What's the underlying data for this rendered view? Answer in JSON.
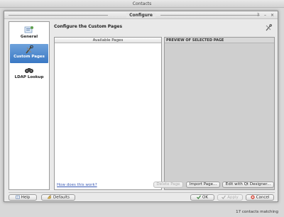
{
  "outer_window": {
    "title": "Contacts",
    "status": "17 contacts matching"
  },
  "dialog": {
    "title": "Configure",
    "window_buttons": [
      "?",
      "–",
      "×"
    ]
  },
  "sidebar": {
    "items": [
      {
        "label": "General",
        "icon": "general-icon",
        "active": false
      },
      {
        "label": "Custom Pages",
        "icon": "tools-icon",
        "active": true
      },
      {
        "label": "LDAP Lookup",
        "icon": "binoculars-icon",
        "active": false
      }
    ]
  },
  "content": {
    "title": "Configure the Custom Pages",
    "available_pages_header": "Available Pages",
    "preview_header": "PREVIEW OF SELECTED PAGE",
    "how_link": "How does this work?",
    "delete_page": "Delete Page",
    "import_page": "Import Page...",
    "edit_designer": "Edit with Qt Designer..."
  },
  "footer": {
    "help": "Help",
    "defaults": "Defaults",
    "ok": "OK",
    "apply": "Apply",
    "cancel": "Cancel"
  },
  "colors": {
    "selection": "#4a86cf",
    "link": "#3b5bb5"
  }
}
